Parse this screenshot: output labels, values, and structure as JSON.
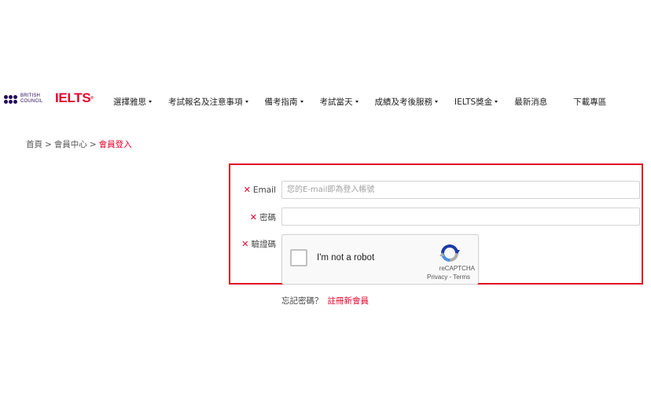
{
  "header": {
    "brand_line1": "BRITISH",
    "brand_line2": "COUNCIL",
    "logo_text": "IELTS",
    "nav": [
      {
        "label": "選擇雅思",
        "dropdown": true
      },
      {
        "label": "考試報名及注意事項",
        "dropdown": true
      },
      {
        "label": "備考指南",
        "dropdown": true
      },
      {
        "label": "考試當天",
        "dropdown": true
      },
      {
        "label": "成績及考後服務",
        "dropdown": true
      },
      {
        "label": "IELTS獎金",
        "dropdown": true
      },
      {
        "label": "最新消息",
        "dropdown": false
      },
      {
        "label": "下載專區",
        "dropdown": false
      }
    ]
  },
  "breadcrumb": {
    "items": [
      "首頁",
      "會員中心",
      "會員登入"
    ],
    "separator": ">"
  },
  "login": {
    "required_mark": "✕",
    "email_label": "Email",
    "email_placeholder": "您的E-mail即為登入帳號",
    "email_value": "",
    "password_label": "密碼",
    "password_value": "",
    "captcha_label": "驗證碼",
    "captcha": {
      "checkbox_text": "I'm not a robot",
      "brand": "reCAPTCHA",
      "privacy": "Privacy",
      "separator": " - ",
      "terms": "Terms",
      "checked": false
    }
  },
  "links": {
    "forgot_password": "忘記密碼？",
    "register": "註冊新會員"
  },
  "colors": {
    "accent_red": "#e4002b",
    "highlight_border": "#e00c20",
    "bc_navy": "#23085a"
  }
}
